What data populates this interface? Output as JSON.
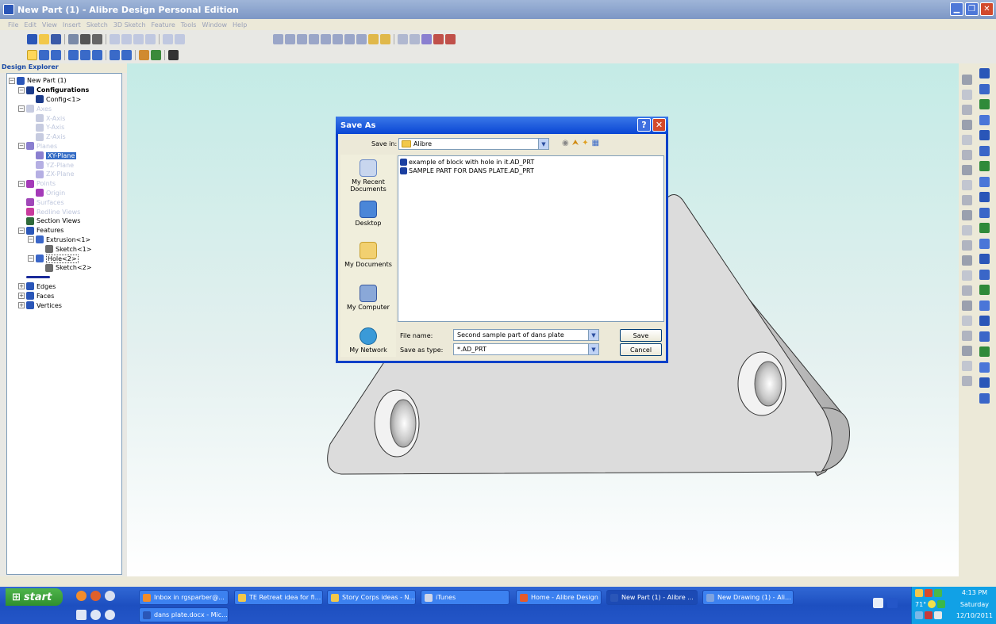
{
  "window": {
    "title": "New Part (1) - Alibre Design Personal Edition",
    "controls": [
      "minimize",
      "restore",
      "close"
    ]
  },
  "menubar": [
    "File",
    "Edit",
    "View",
    "Insert",
    "Sketch",
    "3D Sketch",
    "Feature",
    "Tools",
    "Window",
    "Help"
  ],
  "explorer": {
    "header": "Design Explorer",
    "items": [
      {
        "label": "New Part (1)",
        "depth": 0,
        "expander": "-",
        "icon": "part-icon",
        "color": "#2a56b8",
        "state": ""
      },
      {
        "label": "Configurations",
        "depth": 1,
        "expander": "-",
        "icon": "table-icon",
        "color": "#1a3a8a",
        "state": "bold"
      },
      {
        "label": "Config<1>",
        "depth": 2,
        "expander": "",
        "icon": "table-icon",
        "color": "#1a3a8a",
        "state": ""
      },
      {
        "label": "Axes",
        "depth": 1,
        "expander": "-",
        "icon": "axis-icon",
        "color": "#c6cbe0",
        "state": "dim"
      },
      {
        "label": "X-Axis",
        "depth": 2,
        "expander": "",
        "icon": "axis-icon",
        "color": "#c6cbe0",
        "state": "dim"
      },
      {
        "label": "Y-Axis",
        "depth": 2,
        "expander": "",
        "icon": "axis-icon",
        "color": "#c6cbe0",
        "state": "dim"
      },
      {
        "label": "Z-Axis",
        "depth": 2,
        "expander": "",
        "icon": "axis-icon",
        "color": "#c6cbe0",
        "state": "dim"
      },
      {
        "label": "Planes",
        "depth": 1,
        "expander": "-",
        "icon": "plane-icon",
        "color": "#8a7fd0",
        "state": "dim"
      },
      {
        "label": "XY-Plane",
        "depth": 2,
        "expander": "",
        "icon": "plane-icon",
        "color": "#8a7fd0",
        "state": "selected"
      },
      {
        "label": "YZ-Plane",
        "depth": 2,
        "expander": "",
        "icon": "plane-icon",
        "color": "#b5afe3",
        "state": "dim"
      },
      {
        "label": "ZX-Plane",
        "depth": 2,
        "expander": "",
        "icon": "plane-icon",
        "color": "#b5afe3",
        "state": "dim"
      },
      {
        "label": "Points",
        "depth": 1,
        "expander": "-",
        "icon": "point-icon",
        "color": "#a43ab8",
        "state": "dim"
      },
      {
        "label": "Origin",
        "depth": 2,
        "expander": "",
        "icon": "point-icon",
        "color": "#a43ab8",
        "state": "dim"
      },
      {
        "label": "Surfaces",
        "depth": 1,
        "expander": "",
        "icon": "surface-icon",
        "color": "#a047b8",
        "state": "dim"
      },
      {
        "label": "Redline Views",
        "depth": 1,
        "expander": "",
        "icon": "redline-icon",
        "color": "#c83a9c",
        "state": "dim"
      },
      {
        "label": "Section Views",
        "depth": 1,
        "expander": "",
        "icon": "section-icon",
        "color": "#2f6a3a",
        "state": ""
      },
      {
        "label": "Features",
        "depth": 1,
        "expander": "-",
        "icon": "features-icon",
        "color": "#2a56b8",
        "state": ""
      },
      {
        "label": "Extrusion<1>",
        "depth": 2,
        "expander": "-",
        "icon": "extrusion-icon",
        "color": "#3a66c8",
        "state": ""
      },
      {
        "label": "Sketch<1>",
        "depth": 3,
        "expander": "",
        "icon": "sketch-icon",
        "color": "#6b6b6b",
        "state": ""
      },
      {
        "label": "Hole<2>",
        "depth": 2,
        "expander": "-",
        "icon": "hole-icon",
        "color": "#3a66c8",
        "state": "boxed"
      },
      {
        "label": "Sketch<2>",
        "depth": 3,
        "expander": "",
        "icon": "sketch-icon",
        "color": "#6b6b6b",
        "state": ""
      },
      {
        "label": "",
        "depth": 1,
        "expander": "",
        "icon": "rollback-marker-icon",
        "color": "#1a2a9a",
        "state": ""
      },
      {
        "label": "Edges",
        "depth": 1,
        "expander": "+",
        "icon": "edges-icon",
        "color": "#2a56b8",
        "state": ""
      },
      {
        "label": "Faces",
        "depth": 1,
        "expander": "+",
        "icon": "faces-icon",
        "color": "#2a56b8",
        "state": ""
      },
      {
        "label": "Vertices",
        "depth": 1,
        "expander": "+",
        "icon": "vertices-icon",
        "color": "#2a56b8",
        "state": ""
      }
    ]
  },
  "dialog": {
    "title": "Save As",
    "save_in_label": "Save in:",
    "save_in_value": "Alibre",
    "places": [
      "My Recent Documents",
      "Desktop",
      "My Documents",
      "My Computer",
      "My Network"
    ],
    "files": [
      "example of block with hole in it.AD_PRT",
      "SAMPLE PART FOR DANS PLATE.AD_PRT"
    ],
    "file_name_label": "File name:",
    "file_name_value": "Second sample part of dans plate",
    "save_type_label": "Save as type:",
    "save_type_value": "*.AD_PRT",
    "save_button": "Save",
    "cancel_button": "Cancel"
  },
  "taskbar": {
    "start_label": "start",
    "tasks_row1": [
      {
        "label": "Inbox in rgsparber@...",
        "icon": "mail-icon",
        "color": "#f28c2a",
        "active": false
      },
      {
        "label": "TE Retreat idea for fi...",
        "icon": "folder-icon",
        "color": "#f2c84b",
        "active": false
      },
      {
        "label": "Story Corps ideas - N...",
        "icon": "folder-icon",
        "color": "#f2c84b",
        "active": false
      },
      {
        "label": "iTunes",
        "icon": "itunes-icon",
        "color": "#d0d6e8",
        "active": false
      },
      {
        "label": "Home - Alibre Design ...",
        "icon": "alibre-icon",
        "color": "#e65a2a",
        "active": false
      },
      {
        "label": "New Part (1) - Alibre ...",
        "icon": "alibre-part-icon",
        "color": "#2a56b8",
        "active": true
      },
      {
        "label": "New Drawing (1) - Ali...",
        "icon": "alibre-drawing-icon",
        "color": "#7ea3e0",
        "active": false
      }
    ],
    "tasks_row2": [
      {
        "label": "dans plate.docx - Mic...",
        "icon": "word-icon",
        "color": "#2a56b8",
        "active": false
      }
    ],
    "clock": {
      "time": "4:13 PM",
      "day": "Saturday",
      "date": "12/10/2011"
    },
    "weather": "71°"
  },
  "colors": {
    "xp_blue": "#0a46d4",
    "selection": "#316ac5",
    "part_gray": "#dcdcdc"
  }
}
